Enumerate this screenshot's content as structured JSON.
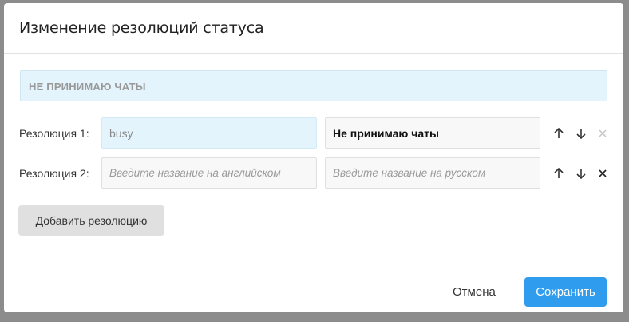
{
  "dialog": {
    "title": "Изменение резолюций статуса",
    "status_name": "НЕ ПРИНИМАЮ ЧАТЫ"
  },
  "resolutions": [
    {
      "label": "Резолюция 1:",
      "en_value": "busy",
      "ru_value": "Не принимаю чаты",
      "icons": [
        "arrow-up-icon",
        "arrow-down-icon",
        "close-icon"
      ],
      "remove_enabled": false
    },
    {
      "label": "Резолюция 2:",
      "en_placeholder": "Введите название на английском",
      "ru_placeholder": "Введите название на русском",
      "icons": [
        "arrow-up-icon",
        "arrow-down-icon",
        "close-icon"
      ],
      "remove_enabled": true
    }
  ],
  "buttons": {
    "add_resolution": "Добавить резолюцию",
    "cancel": "Отмена",
    "save": "Сохранить"
  },
  "colors": {
    "accent": "#2f9ced",
    "active_field": "#e3f4fc",
    "overlay": "#8c8c8c"
  }
}
